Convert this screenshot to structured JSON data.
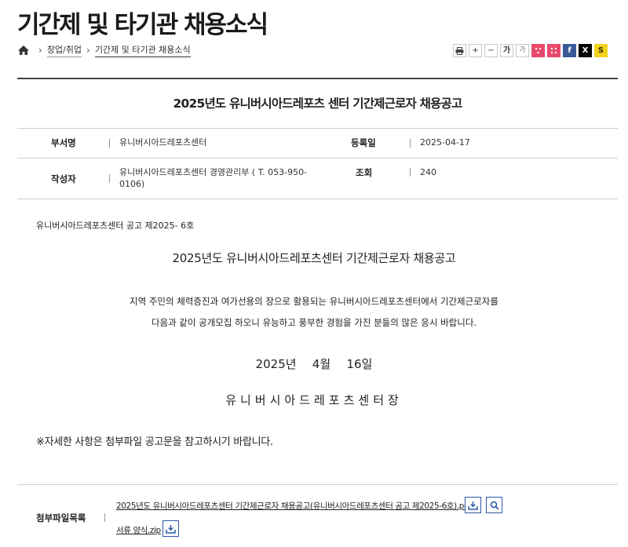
{
  "page": {
    "title": "기간제 및 타기관 채용소식"
  },
  "breadcrumb": {
    "home_icon": "home-icon",
    "items": [
      "창업/취업",
      "기간제 및 타기관 채용소식"
    ]
  },
  "tools": {
    "print_icon": "printer-icon",
    "zoom_in": "+",
    "zoom_out": "−",
    "font_large": "가",
    "font_small": "가",
    "share_icons": [
      "share-pink-icon",
      "share-pink-icon",
      "facebook-icon",
      "x-icon",
      "kakaostory-icon"
    ],
    "facebook": "f",
    "x": "X",
    "story": "S",
    "colors": {
      "pink": "#e84a6c",
      "facebook": "#3b5998",
      "x": "#000000",
      "story": "#f3d21b"
    }
  },
  "post": {
    "title": "2025년도 유니버시아드레포츠 센터 기간제근로자 채용공고",
    "meta": {
      "dept_label": "부서명",
      "dept_value": "유니버시아드레포츠센터",
      "date_label": "등록일",
      "date_value": "2025-04-17",
      "author_label": "작성자",
      "author_value": "유니버시아드레포츠센터 경영관리부 ( T. 053-950-0106)",
      "views_label": "조회",
      "views_value": "240"
    },
    "content": {
      "notice_no": "유니버시아드레포츠센터 공고 제2025- 6호",
      "title": "2025년도 유니버시아드레포츠센터 기간제근로자 채용공고",
      "line1": "지역 주민의 체력증진과 여가선용의 장으로 활용되는 유니버시아드레포츠센터에서 기간제근로자를",
      "line2": "다음과 같이 공개모집 하오니 유능하고 풍부한 경험을 가진 분들의 많은 응시 바랍니다.",
      "date": "2025년   4월   16일",
      "org": "유니버시아드레포츠센터장",
      "detail": "※자세한 사항은 첨부파일 공고문을 참고하시기 바랍니다."
    },
    "attachments": {
      "label": "첨부파일목록",
      "files": [
        {
          "name": "2025년도 유니버시아드레포츠센터 기간제근로자 채용공고(유니버시아드레포츠센터 공고 제2025-6호).pdf",
          "icons": [
            "download-icon",
            "preview-search-icon"
          ]
        },
        {
          "name": "서류 양식.zip",
          "icons": [
            "download-icon"
          ]
        }
      ]
    }
  }
}
